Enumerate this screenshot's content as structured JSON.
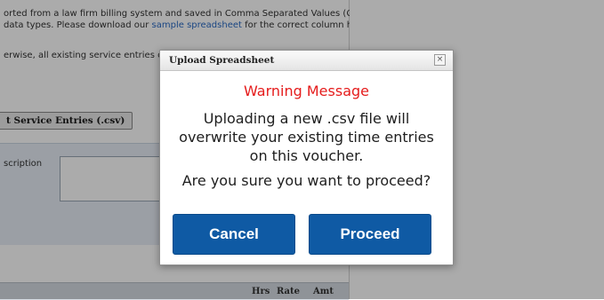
{
  "background_page": {
    "intro_line_1": "orted from a law firm billing system and saved in Comma Separated Values (CSV)",
    "intro_line_2_pre": "data types. Please download our ",
    "intro_line_2_link": "sample spreadsheet",
    "intro_line_2_post": " for the correct column headings",
    "note": "erwise, all existing service entries on th",
    "import_button": "t Service Entries (.csv)",
    "description_label": "scription",
    "table_headers": {
      "hrs": "Hrs",
      "rate": "Rate",
      "amt": "Amt"
    }
  },
  "dialog": {
    "title": "Upload Spreadsheet",
    "close_glyph": "×",
    "warning_title": "Warning Message",
    "message_lines": [
      "Uploading a new .csv file will",
      "overwrite your existing time entries",
      "on this voucher."
    ],
    "question": "Are you sure you want to proceed?",
    "cancel_label": "Cancel",
    "proceed_label": "Proceed"
  },
  "colors": {
    "warning": "#e51c1c",
    "button": "#0f5aa4",
    "overlay": "rgba(0,0,0,0.33)"
  }
}
